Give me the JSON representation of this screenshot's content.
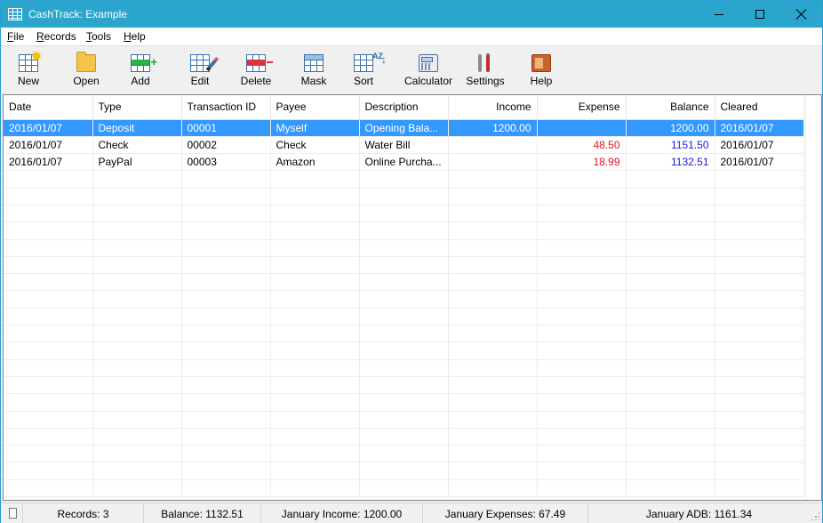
{
  "window": {
    "title": "CashTrack: Example"
  },
  "menu": [
    "File",
    "Records",
    "Tools",
    "Help"
  ],
  "toolbar": {
    "new": "New",
    "open": "Open",
    "add": "Add",
    "edit": "Edit",
    "delete": "Delete",
    "mask": "Mask",
    "sort": "Sort",
    "sort_az": "AZ",
    "calculator": "Calculator",
    "settings": "Settings",
    "help": "Help"
  },
  "table": {
    "columns": [
      "Date",
      "Type",
      "Transaction ID",
      "Payee",
      "Description",
      "Income",
      "Expense",
      "Balance",
      "Cleared"
    ],
    "rows": [
      [
        "2016/01/07",
        "Deposit",
        "00001",
        "Myself",
        "Opening Bala...",
        "1200.00",
        "",
        "1200.00",
        "2016/01/07"
      ],
      [
        "2016/01/07",
        "Check",
        "00002",
        "Check",
        "Water Bill",
        "",
        "48.50",
        "1151.50",
        "2016/01/07"
      ],
      [
        "2016/01/07",
        "PayPal",
        "00003",
        "Amazon",
        "Online Purcha...",
        "",
        "18.99",
        "1132.51",
        "2016/01/07"
      ]
    ],
    "selected_row": 0
  },
  "status": {
    "records": "Records: 3",
    "balance": "Balance: 1132.51",
    "income": "January Income: 1200.00",
    "expenses": "January Expenses: 67.49",
    "adb": "January ADB: 1161.34"
  },
  "colors": {
    "titlebar": "#2aa6cd",
    "selection": "#3399ff",
    "expense": "#e8141c",
    "balance": "#1a1adc"
  },
  "icons": [
    "app-grid-icon",
    "minimize-icon",
    "maximize-icon",
    "close-icon",
    "new-icon",
    "folder-icon",
    "add-row-icon",
    "edit-icon",
    "delete-row-icon",
    "mask-icon",
    "sort-icon",
    "calculator-icon",
    "settings-icon",
    "help-book-icon",
    "status-doc-icon",
    "resize-grip-icon"
  ]
}
